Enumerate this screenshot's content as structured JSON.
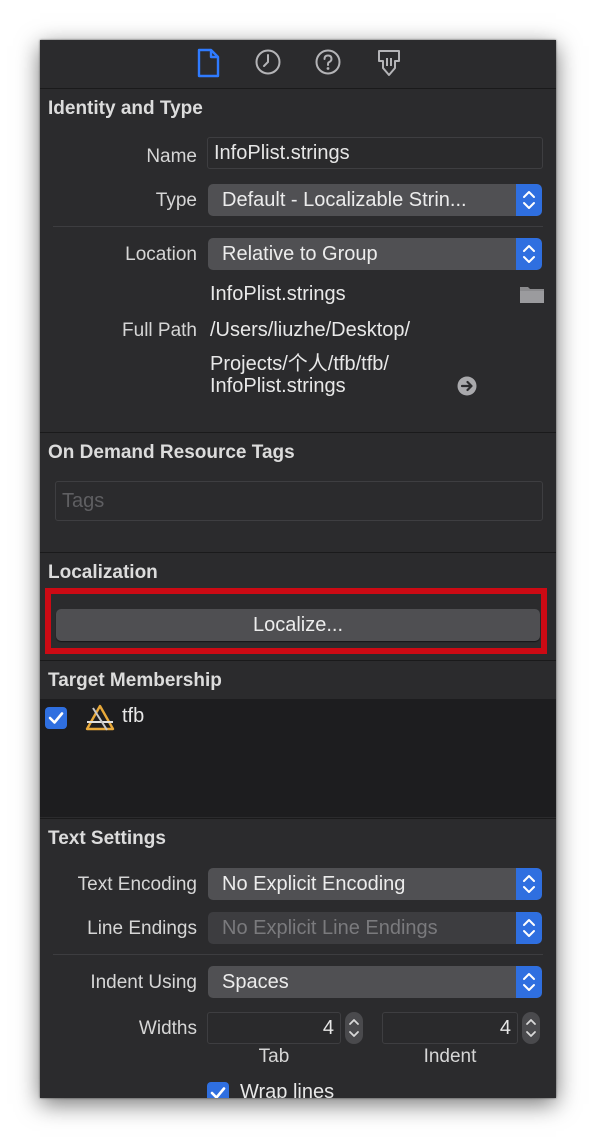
{
  "toolbar": {
    "icons": [
      "file-inspector-icon",
      "history-icon",
      "help-icon",
      "identity-icon"
    ]
  },
  "identity": {
    "title": "Identity and Type",
    "name_label": "Name",
    "name_value": "InfoPlist.strings",
    "type_label": "Type",
    "type_value": "Default - Localizable Strin...",
    "location_label": "Location",
    "location_value": "Relative to Group",
    "location_file": "InfoPlist.strings",
    "full_path_label": "Full Path",
    "full_path_line1": "/Users/liuzhe/Desktop/",
    "full_path_line2": "Projects/个人/tfb/tfb/",
    "full_path_line3": "InfoPlist.strings"
  },
  "odr": {
    "title": "On Demand Resource Tags",
    "tags_placeholder": "Tags"
  },
  "localization": {
    "title": "Localization",
    "button_label": "Localize..."
  },
  "target": {
    "title": "Target Membership",
    "items": [
      {
        "name": "tfb",
        "checked": true
      }
    ]
  },
  "text_settings": {
    "title": "Text Settings",
    "encoding_label": "Text Encoding",
    "encoding_value": "No Explicit Encoding",
    "line_endings_label": "Line Endings",
    "line_endings_value": "No Explicit Line Endings",
    "indent_using_label": "Indent Using",
    "indent_using_value": "Spaces",
    "widths_label": "Widths",
    "tab_value": "4",
    "indent_value": "4",
    "tab_label": "Tab",
    "indent_label": "Indent",
    "wrap_lines_label": "Wrap lines",
    "wrap_lines_checked": true
  },
  "colors": {
    "accent": "#2f6fe0",
    "annotation_red": "#cc0a14",
    "panel_bg": "#2b2b2d"
  }
}
